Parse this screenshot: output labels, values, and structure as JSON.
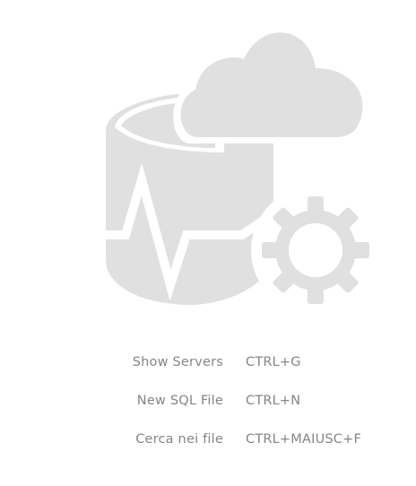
{
  "watermark": {
    "icon": "database-cloud-gear-icon",
    "color": "#e0e0e0"
  },
  "shortcuts": [
    {
      "label": "Show Servers",
      "keys": "CTRL+G"
    },
    {
      "label": "New SQL File",
      "keys": "CTRL+N"
    },
    {
      "label": "Cerca nei file",
      "keys": "CTRL+MAIUSC+F"
    }
  ],
  "colors": {
    "background": "#ffffff",
    "text": "#858585",
    "watermark": "#e0e0e0"
  }
}
